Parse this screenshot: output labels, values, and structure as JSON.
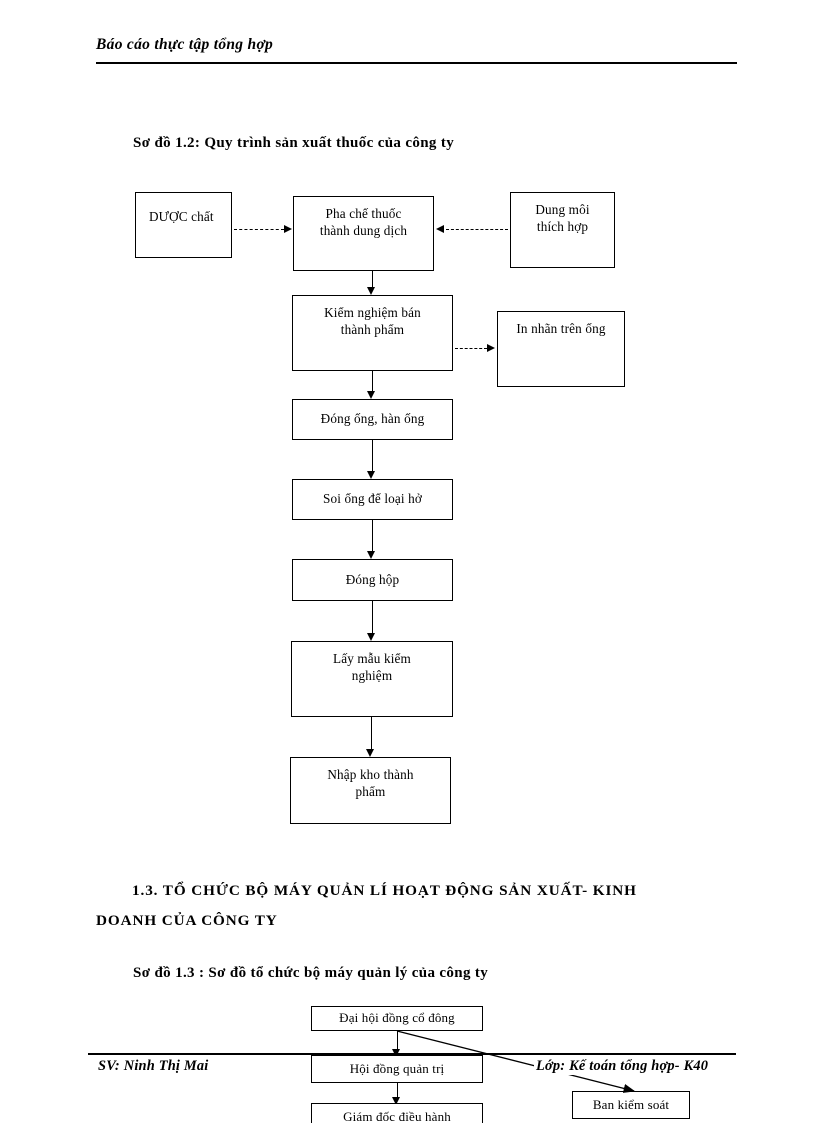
{
  "header": {
    "running_title": "Báo cáo thực tập tổng hợp"
  },
  "footer": {
    "student": "SV: Ninh Thị Mai",
    "class": "Lớp: Kế toán tổng hợp- K40"
  },
  "figure_1_2": {
    "caption": "Sơ đồ 1.2: Quy trình sản xuất thuốc của công ty",
    "nodes": [
      {
        "id": "duoc-chat",
        "label": "DƯỢC chất"
      },
      {
        "id": "pha-che",
        "label": "Pha chế thuốc\nthành dung  dịch"
      },
      {
        "id": "dung-moi",
        "label": "Dung môi\nthích hợp"
      },
      {
        "id": "kiem-nghiem-ban",
        "label": "Kiểm nghiệm bán\nthành phẩm"
      },
      {
        "id": "in-nhan",
        "label": "In nhãn trên ống"
      },
      {
        "id": "dong-ong",
        "label": "Đóng ống, hàn ống"
      },
      {
        "id": "soi-ong",
        "label": "Soi ống để loại hở"
      },
      {
        "id": "dong-hop",
        "label": "Đóng hộp"
      },
      {
        "id": "lay-mau",
        "label": "Lấy mẫu kiểm\nnghiệm"
      },
      {
        "id": "nhap-kho",
        "label": "Nhập kho thành\nphẩm"
      }
    ],
    "node_labels": {
      "duoc_chat": "DƯỢC chất",
      "pha_che_line1": "Pha chế thuốc",
      "pha_che_line2": "thành dung  dịch",
      "dung_moi_line1": "Dung môi",
      "dung_moi_line2": "thích hợp",
      "kiem_nghiem_line1": "Kiểm nghiệm bán",
      "kiem_nghiem_line2": "thành phẩm",
      "in_nhan": "In nhãn trên ống",
      "dong_ong": "Đóng ống, hàn ống",
      "soi_ong": "Soi ống để loại hở",
      "dong_hop": "Đóng hộp",
      "lay_mau_line1": "Lấy mẫu kiểm",
      "lay_mau_line2": "nghiệm",
      "nhap_kho_line1": "Nhập kho thành",
      "nhap_kho_line2": "phẩm"
    }
  },
  "section_1_3": {
    "number": "1.3.",
    "title": "TỔ CHỨC BỘ MÁY QUẢN LÍ HOẠT ĐỘNG SẢN XUẤT- KINH DOANH CỦA CÔNG TY",
    "line1": "1.3. TỔ CHỨC BỘ MÁY QUẢN LÍ HOẠT ĐỘNG SẢN XUẤT- KINH",
    "line2": "DOANH CỦA CÔNG TY"
  },
  "figure_1_3": {
    "caption": "Sơ đồ 1.3 : Sơ đồ tổ chức bộ máy quản lý của công ty",
    "node_labels": {
      "dai_hoi_dong": "Đại hội đồng cổ đông",
      "hoi_dong_quan_tri": "Hội đồng quản trị",
      "giam_doc": "Giám đốc điều hành",
      "ban_kiem_soat": "Ban kiểm soát"
    }
  },
  "colors": {
    "text": "#000000",
    "page_background": "#ffffff",
    "rule": "#000000"
  }
}
